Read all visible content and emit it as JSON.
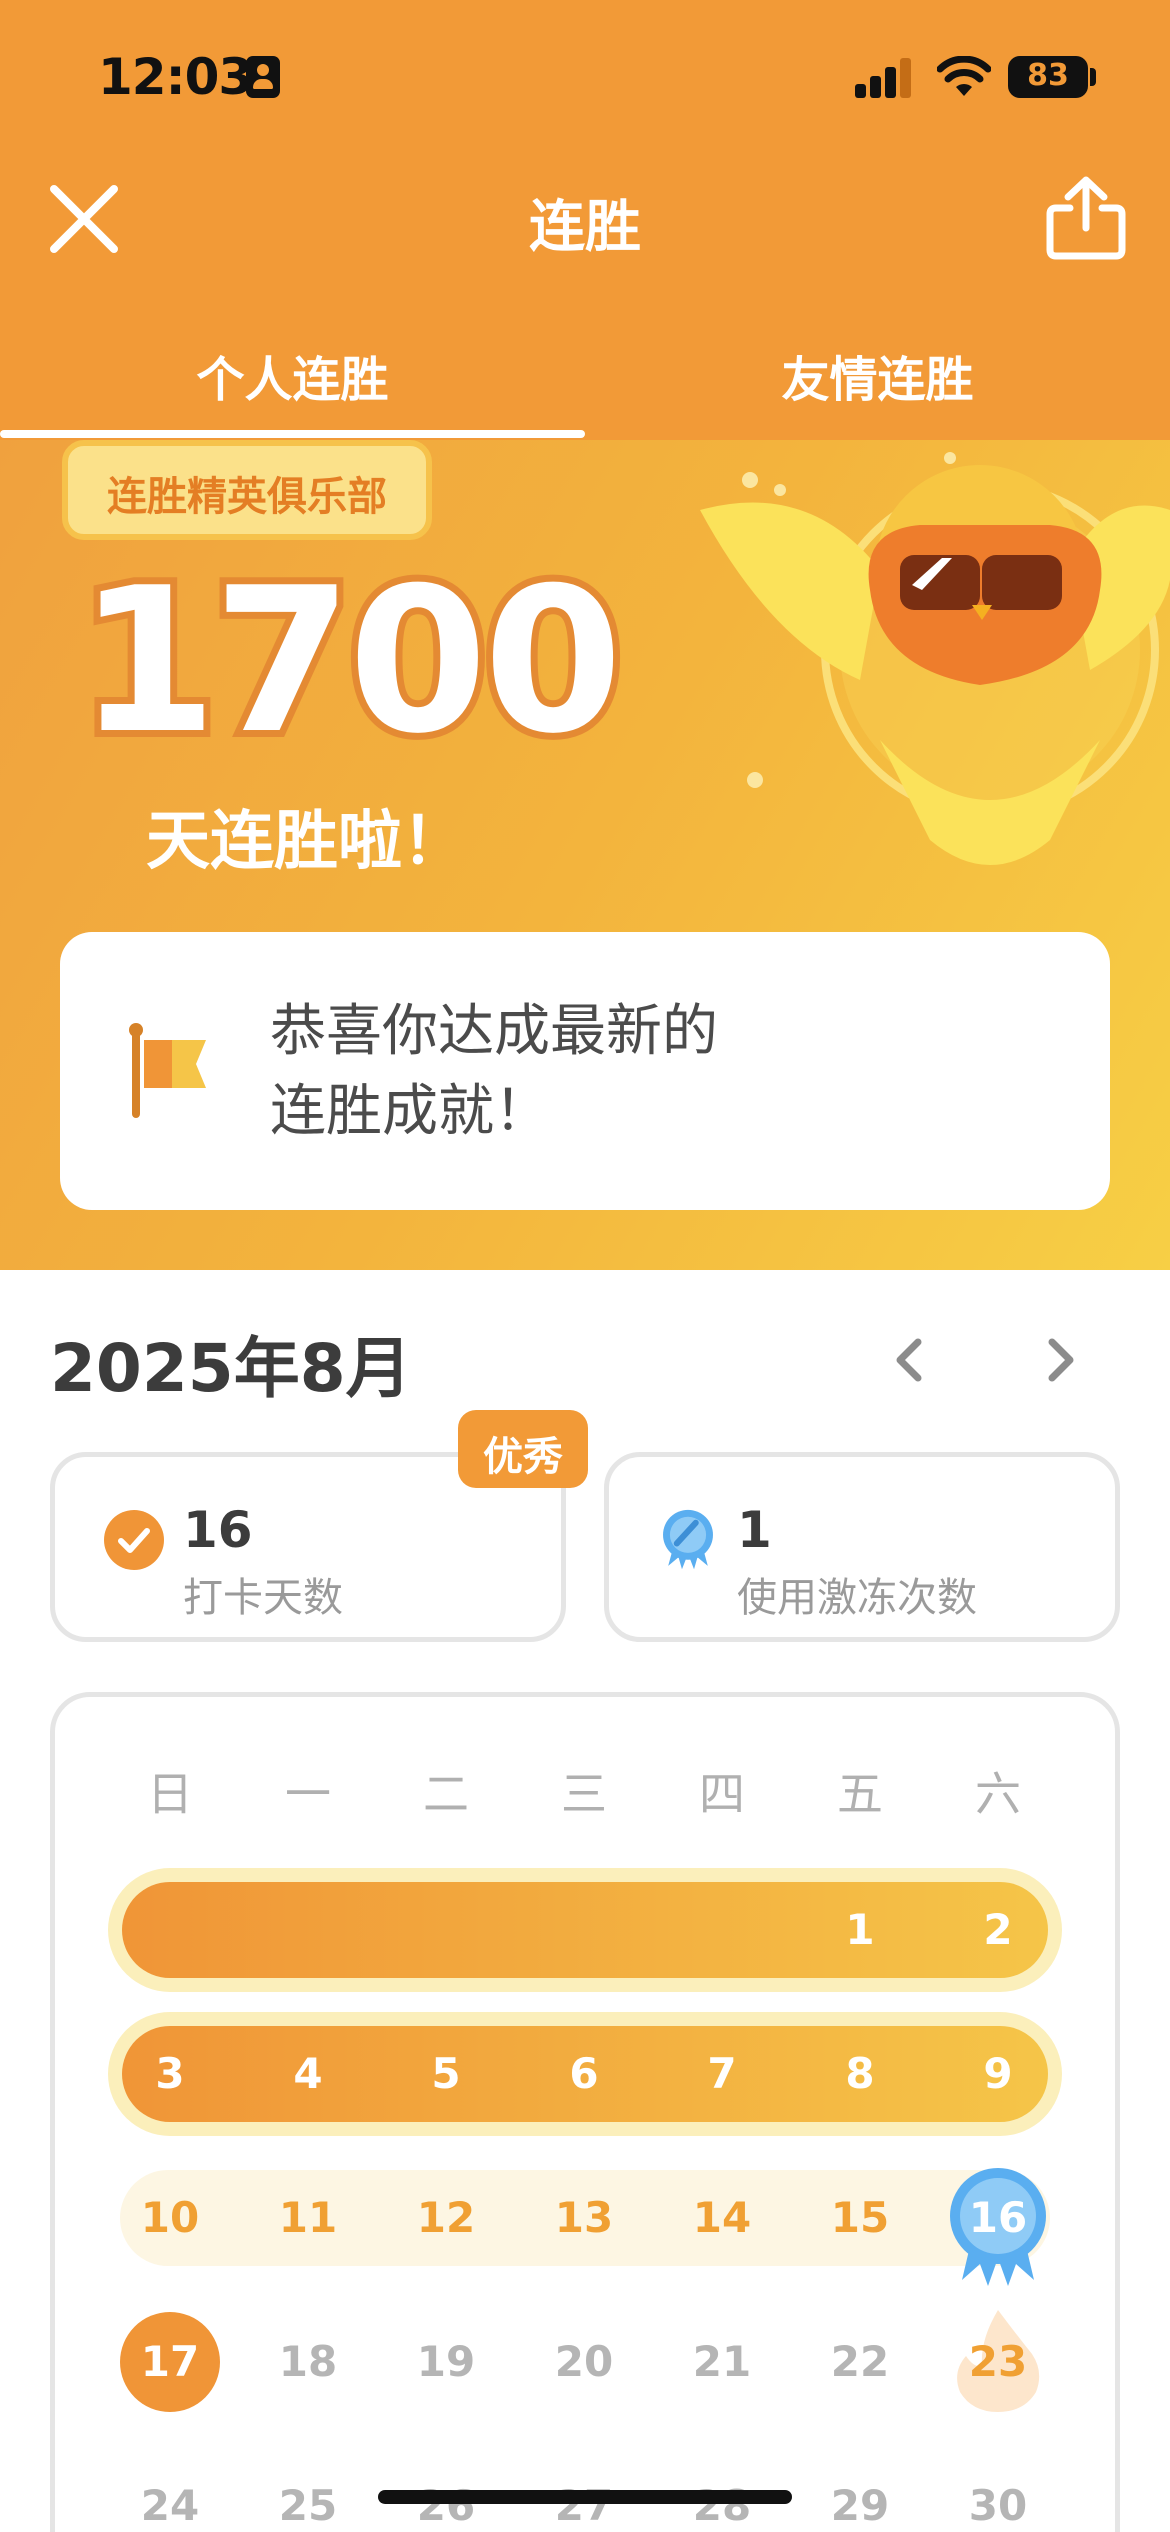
{
  "status_bar": {
    "time": "12:03",
    "battery": "83"
  },
  "nav": {
    "title": "连胜"
  },
  "tabs": [
    {
      "label": "个人连胜",
      "active": true
    },
    {
      "label": "友情连胜",
      "active": false
    }
  ],
  "hero": {
    "club_badge": "连胜精英俱乐部",
    "streak_count": "1700",
    "streak_caption": "天连胜啦！",
    "congrats_line1": "恭喜你达成最新的",
    "congrats_line2": "连胜成就！"
  },
  "calendar": {
    "month_title": "2025年8月",
    "stats": {
      "checkin_days": "16",
      "checkin_label": "打卡天数",
      "badge": "优秀",
      "freeze_count": "1",
      "freeze_label": "使用激冻次数"
    },
    "weekdays": [
      "日",
      "一",
      "二",
      "三",
      "四",
      "五",
      "六"
    ],
    "days": [
      "1",
      "2",
      "3",
      "4",
      "5",
      "6",
      "7",
      "8",
      "9",
      "10",
      "11",
      "12",
      "13",
      "14",
      "15",
      "16",
      "17",
      "18",
      "19",
      "20",
      "21",
      "22",
      "23",
      "24",
      "25",
      "26",
      "27",
      "28",
      "29",
      "30"
    ]
  },
  "colors": {
    "accent_orange": "#f29a37",
    "streak_yellow": "#f5c548",
    "freeze_blue": "#5aaef0"
  }
}
